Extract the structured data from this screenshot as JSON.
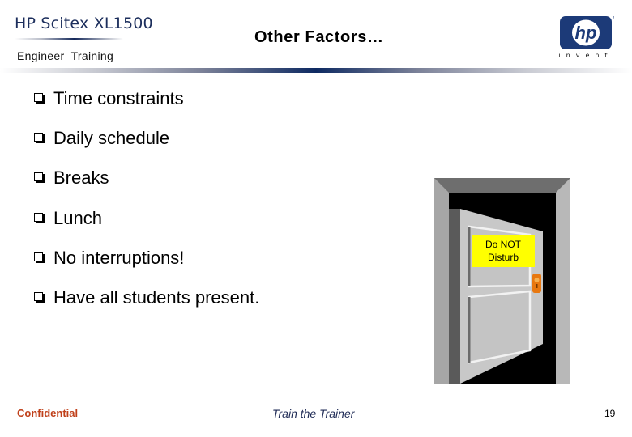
{
  "header": {
    "product": "HP Scitex XL1500",
    "subtitle": "Engineer  Training",
    "title": "Other Factors…",
    "logo_text": "hp",
    "logo_tagline": "invent"
  },
  "bullets": [
    {
      "text": "Time constraints"
    },
    {
      "text": "Daily schedule"
    },
    {
      "text": "Breaks"
    },
    {
      "text": "Lunch"
    },
    {
      "text": "No interruptions!"
    },
    {
      "text": "Have all students present."
    }
  ],
  "illustration": {
    "sign_line1": "Do NOT",
    "sign_line2": "Disturb"
  },
  "footer": {
    "left": "Confidential",
    "center": "Train the Trainer",
    "page": "19"
  },
  "colors": {
    "brand_navy": "#14285a",
    "confidential": "#c0401a",
    "footer_center": "#1e2a55",
    "sign_yellow": "#ffff00",
    "knob_orange": "#e87810"
  }
}
